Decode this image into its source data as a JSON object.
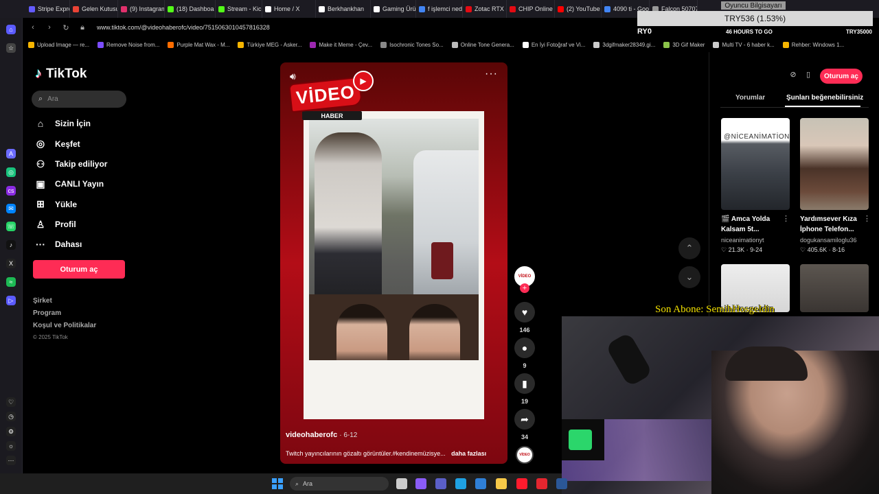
{
  "browser": {
    "tabs": [
      {
        "label": "Stripe Express",
        "color": "#635bff"
      },
      {
        "label": "Gelen Kutusu",
        "color": "#ea4335"
      },
      {
        "label": "(9) Instagram",
        "color": "#e1306c"
      },
      {
        "label": "(18) Dashboa",
        "color": "#53fc18"
      },
      {
        "label": "Stream - Kick",
        "color": "#53fc18"
      },
      {
        "label": "Home / X",
        "color": "#ffffff"
      },
      {
        "label": "Berkhankhan",
        "color": "#ffffff"
      },
      {
        "label": "Gaming Ürün",
        "color": "#ffffff"
      },
      {
        "label": "f işlemci nedi",
        "color": "#4285f4"
      },
      {
        "label": "Zotac RTX 50",
        "color": "#e30b13"
      },
      {
        "label": "CHIP Online",
        "color": "#e30b13"
      },
      {
        "label": "(2) YouTube",
        "color": "#ff0000"
      },
      {
        "label": "4090 ti - Goo",
        "color": "#4285f4"
      },
      {
        "label": "Falcon 50707",
        "color": "#999999"
      }
    ],
    "url": "www.tiktok.com/@videohaberofc/video/7515063010457816328",
    "bookmarks": [
      {
        "label": "Upload Image — re...",
        "color": "#f7b500"
      },
      {
        "label": "Remove Noise from...",
        "color": "#7c4dff"
      },
      {
        "label": "Purple Mat Wax - M...",
        "color": "#ff6d00"
      },
      {
        "label": "Türkiye MEG - Asker...",
        "color": "#f7b500"
      },
      {
        "label": "Make it Meme - Çev...",
        "color": "#9c27b0"
      },
      {
        "label": "Isochronic Tones So...",
        "color": "#888888"
      },
      {
        "label": "Online Tone Genera...",
        "color": "#bbbbbb"
      },
      {
        "label": "En İyi Fotoğraf ve Vi...",
        "color": "#ffffff"
      },
      {
        "label": "3dgifmaker28349.gi...",
        "color": "#cccccc"
      },
      {
        "label": "3D Gif Maker",
        "color": "#8bc34a"
      },
      {
        "label": "Multi TV - 6 haber k...",
        "color": "#cccccc"
      },
      {
        "label": "Rehber: Windows 1...",
        "color": "#f7b500"
      }
    ]
  },
  "sidebar_icons": [
    {
      "name": "opera-icon",
      "glyph": "O",
      "color": "#ff1b2d"
    },
    {
      "name": "home-icon",
      "glyph": "⌂",
      "color": "#5b5bff"
    },
    {
      "name": "star-icon",
      "glyph": "☆",
      "color": "#444444"
    },
    {
      "name": "aria-icon",
      "glyph": "A",
      "color": "#6b6bff"
    },
    {
      "name": "chatgpt-icon",
      "glyph": "◎",
      "color": "#19c37d"
    },
    {
      "name": "cs-icon",
      "glyph": "cs",
      "color": "#8a2be2"
    },
    {
      "name": "messenger-icon",
      "glyph": "✉",
      "color": "#0084ff"
    },
    {
      "name": "whatsapp-icon",
      "glyph": "☏",
      "color": "#25d366"
    },
    {
      "name": "tiktok-icon",
      "glyph": "♪",
      "color": "#111111"
    },
    {
      "name": "x-icon",
      "glyph": "X",
      "color": "#222222"
    },
    {
      "name": "spotify-icon",
      "glyph": "≈",
      "color": "#1db954"
    },
    {
      "name": "player-icon",
      "glyph": "▷",
      "color": "#5b5bff"
    },
    {
      "name": "heart-icon",
      "glyph": "♡",
      "color": "#222222"
    },
    {
      "name": "history-icon",
      "glyph": "◷",
      "color": "#222222"
    },
    {
      "name": "settings-icon",
      "glyph": "⚙",
      "color": "#222222"
    },
    {
      "name": "lightbulb-icon",
      "glyph": "☼",
      "color": "#222222"
    },
    {
      "name": "more-icon",
      "glyph": "···",
      "color": "#222222"
    }
  ],
  "tiktok": {
    "logo": "TikTok",
    "search_placeholder": "Ara",
    "nav": [
      {
        "label": "Sizin İçin",
        "icon": "⌂",
        "name": "home"
      },
      {
        "label": "Keşfet",
        "icon": "◎",
        "name": "explore"
      },
      {
        "label": "Takip ediliyor",
        "icon": "⚇",
        "name": "following"
      },
      {
        "label": "CANLI Yayın",
        "icon": "▣",
        "name": "live"
      },
      {
        "label": "Yükle",
        "icon": "⊞",
        "name": "upload"
      },
      {
        "label": "Profil",
        "icon": "♙",
        "name": "profile"
      },
      {
        "label": "Dahası",
        "icon": "···",
        "name": "more"
      }
    ],
    "login_label": "Oturum aç",
    "footer": [
      "Şirket",
      "Program",
      "Koşul ve Politikalar"
    ],
    "copyright": "© 2025 TikTok"
  },
  "video": {
    "badge": "VİDEO",
    "tag": "HABER",
    "author": "videohaberofc",
    "date": "· 6-12",
    "description": "Twitch yayıncılarının gözaltı görüntüler.#kendinemüzisye...",
    "more": "daha fazlası",
    "avatar_text": "VİDEO",
    "likes": "146",
    "comments": "9",
    "saves": "19",
    "shares": "34"
  },
  "right_panel": {
    "login_label": "Oturum aç",
    "tabs": [
      "Yorumlar",
      "Şunları beğenebilirsiniz"
    ],
    "cards": [
      {
        "thumb_text": "@NİCEANİMATİON",
        "title": "🎬 Amca Yolda Kalsam 5t...",
        "user": "niceanimationyt",
        "stats": "♡ 21.3K · 9-24"
      },
      {
        "thumb_text": "",
        "title": "Yardımsever Kıza İphone Telefon...",
        "user": "dogukansamiloglu36",
        "stats": "♡ 405.6K · 8-16"
      }
    ]
  },
  "overlay": {
    "top_label": "Oyuncu Bilgisayarı",
    "goal": "TRY536 (1.53%)",
    "left": "RY0",
    "hours": "46 HOURS TO GO",
    "target": "TRY35000",
    "subscriber": "Son Abone: SemihHosgeldin"
  },
  "taskbar": {
    "search_placeholder": "Ara",
    "apps": [
      {
        "name": "task-view-icon",
        "color": "#cccccc"
      },
      {
        "name": "copilot-icon",
        "color": "#8a5cf6"
      },
      {
        "name": "teams-icon",
        "color": "#5b5fc7"
      },
      {
        "name": "edge-icon",
        "color": "#1fa1e2"
      },
      {
        "name": "store-icon",
        "color": "#2f7fd6"
      },
      {
        "name": "explorer-icon",
        "color": "#f7c948"
      },
      {
        "name": "opera-icon",
        "color": "#ff1b2d"
      },
      {
        "name": "wps-icon",
        "color": "#e3262f"
      },
      {
        "name": "word-icon",
        "color": "#2b5797"
      }
    ]
  }
}
